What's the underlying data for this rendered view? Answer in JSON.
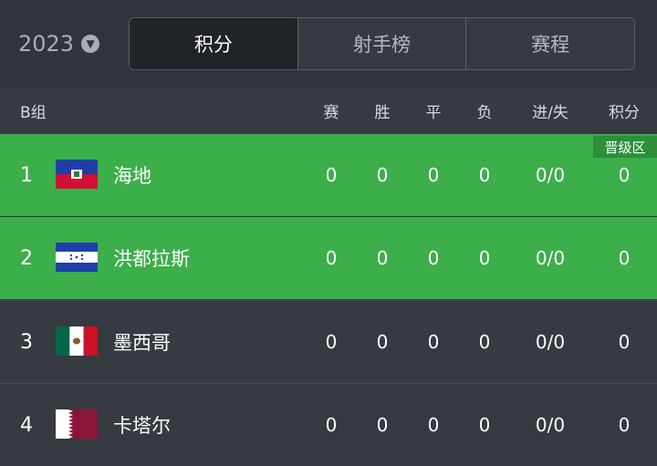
{
  "season": {
    "year": "2023"
  },
  "tabs": [
    {
      "label": "积分",
      "active": true
    },
    {
      "label": "射手榜",
      "active": false
    },
    {
      "label": "赛程",
      "active": false
    }
  ],
  "table": {
    "group": "B组",
    "columns": [
      "赛",
      "胜",
      "平",
      "负",
      "进/失",
      "积分"
    ],
    "qualify_badge": "晋级区",
    "rows": [
      {
        "rank": "1",
        "team": "海地",
        "flag": "haiti-flag",
        "played": "0",
        "won": "0",
        "drawn": "0",
        "lost": "0",
        "goals": "0/0",
        "points": "0",
        "zone": "qualify"
      },
      {
        "rank": "2",
        "team": "洪都拉斯",
        "flag": "honduras-flag",
        "played": "0",
        "won": "0",
        "drawn": "0",
        "lost": "0",
        "goals": "0/0",
        "points": "0",
        "zone": "qualify"
      },
      {
        "rank": "3",
        "team": "墨西哥",
        "flag": "mexico-flag",
        "played": "0",
        "won": "0",
        "drawn": "0",
        "lost": "0",
        "goals": "0/0",
        "points": "0",
        "zone": "none"
      },
      {
        "rank": "4",
        "team": "卡塔尔",
        "flag": "qatar-flag",
        "played": "0",
        "won": "0",
        "drawn": "0",
        "lost": "0",
        "goals": "0/0",
        "points": "0",
        "zone": "none"
      }
    ]
  },
  "colors": {
    "qualify": "#3cae4a",
    "background": "#363a41",
    "active_tab": "#202328"
  }
}
